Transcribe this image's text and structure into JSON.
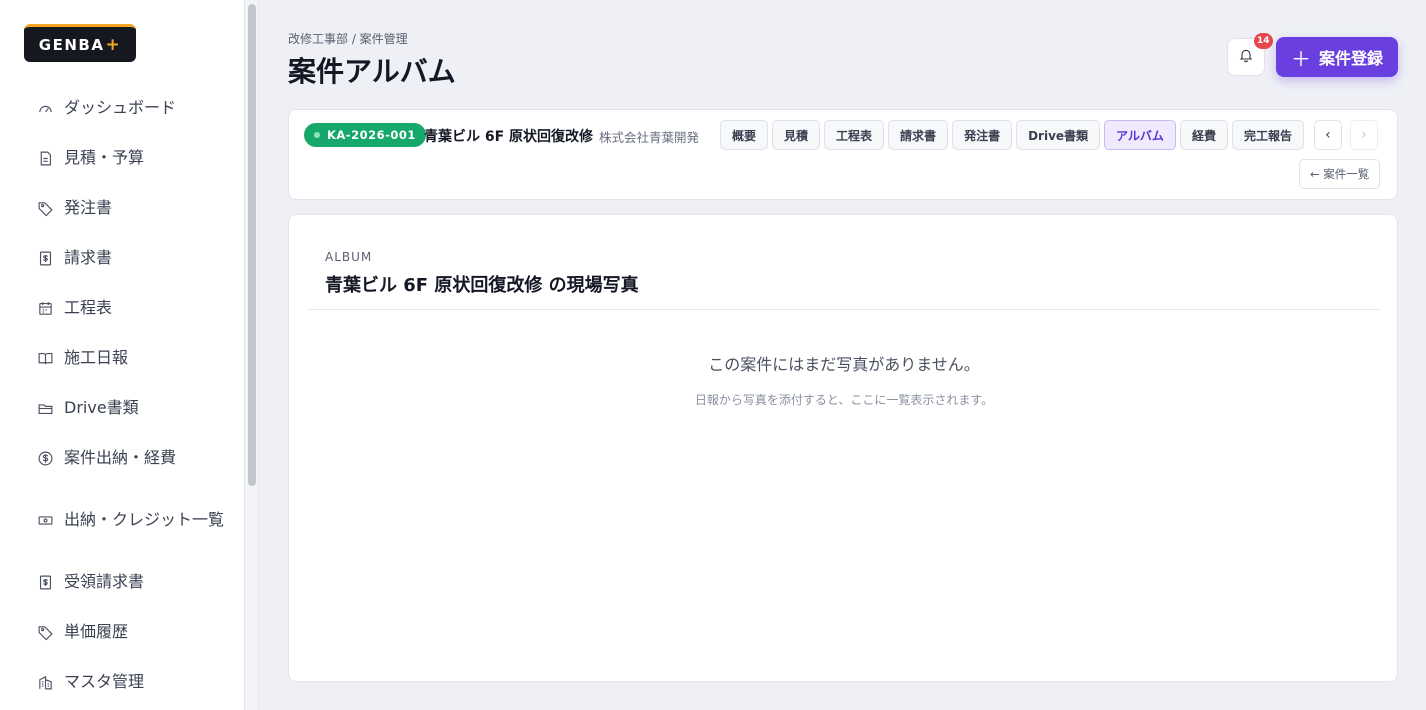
{
  "sidebar": {
    "logo": {
      "text": "GENBA",
      "plus": "+"
    },
    "items": [
      {
        "label": "ダッシュボード",
        "icon": "gauge-icon"
      },
      {
        "label": "見積・予算",
        "icon": "document-icon"
      },
      {
        "label": "発注書",
        "icon": "tag-icon"
      },
      {
        "label": "請求書",
        "icon": "invoice-icon"
      },
      {
        "label": "工程表",
        "icon": "calendar-icon"
      },
      {
        "label": "施工日報",
        "icon": "book-icon"
      },
      {
        "label": "Drive書類",
        "icon": "folder-icon"
      },
      {
        "label": "案件出納・経費",
        "icon": "dollar-circle-icon"
      },
      {
        "label": "出納・クレジット一覧",
        "icon": "banknote-icon"
      },
      {
        "label": "受領請求書",
        "icon": "receipt-icon"
      },
      {
        "label": "単価履歴",
        "icon": "price-tag-icon"
      },
      {
        "label": "マスタ管理",
        "icon": "building-icon"
      }
    ]
  },
  "header": {
    "breadcrumb": "改修工事部 / 案件管理",
    "title": "案件アルバム",
    "notification_count": "14",
    "primary_button": "案件登録",
    "primary_button_icon": "plus"
  },
  "project": {
    "code": "KA-2026-001",
    "name": "青葉ビル 6F 原状回復改修",
    "client": "株式会社青葉開発",
    "tabs": [
      "概要",
      "見積",
      "工程表",
      "請求書",
      "発注書",
      "Drive書類",
      "アルバム",
      "経費",
      "完工報告"
    ],
    "active_tab": "アルバム",
    "prev_arrow": "‹",
    "next_arrow": "›",
    "back_label": "← 案件一覧"
  },
  "album": {
    "eyebrow": "ALBUM",
    "title": "青葉ビル 6F 原状回復改修 の現場写真",
    "empty_title": "この案件にはまだ写真がありません。",
    "empty_sub": "日報から写真を添付すると、ここに一覧表示されます。"
  },
  "colors": {
    "accent": "#6a3fe0",
    "status_green": "#16a86a",
    "badge_red": "#e5484d",
    "logo_orange": "#f5a524"
  }
}
